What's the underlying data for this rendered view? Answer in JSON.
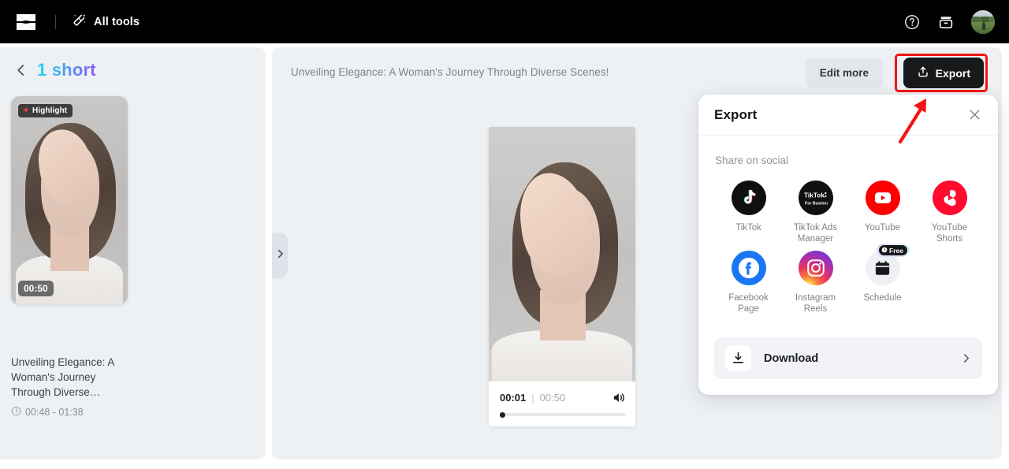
{
  "topbar": {
    "logo_name": "capcut-logo",
    "all_tools_label": "All tools",
    "help_icon": "help-circle-icon",
    "storage_icon": "storage-icon",
    "avatar_name": "user-avatar"
  },
  "sidebar": {
    "back_label": "back-chevron",
    "heading": "1 short",
    "clip": {
      "highlight_badge": "Highlight",
      "duration_badge": "00:50",
      "title": "Unveiling Elegance: A Woman's Journey Through Diverse…",
      "time_range": "00:48 - 01:38",
      "clock_icon": "clock-icon"
    }
  },
  "main": {
    "video_title": "Unveiling Elegance: A Woman's Journey Through Diverse Scenes!",
    "edit_more_label": "Edit more",
    "export_label": "Export",
    "export_icon": "upload-icon",
    "collapse_icon": "chevron-right-icon"
  },
  "player": {
    "current_time": "00:01",
    "separator": "|",
    "total_time": "00:50",
    "volume_icon": "volume-icon",
    "progress_percent": 2
  },
  "export_dialog": {
    "title": "Export",
    "close_icon": "close-icon",
    "share_section_label": "Share on social",
    "socials": [
      {
        "label": "TikTok",
        "icon": "tiktok-icon"
      },
      {
        "label": "TikTok Ads Manager",
        "icon": "tiktok-ads-manager-icon"
      },
      {
        "label": "YouTube",
        "icon": "youtube-icon"
      },
      {
        "label": "YouTube Shorts",
        "icon": "youtube-shorts-icon"
      },
      {
        "label": "Facebook Page",
        "icon": "facebook-icon"
      },
      {
        "label": "Instagram Reels",
        "icon": "instagram-icon"
      },
      {
        "label": "Schedule",
        "icon": "calendar-icon",
        "badge": "Free"
      }
    ],
    "download": {
      "label": "Download",
      "icon": "download-icon",
      "chevron": "chevron-right-icon"
    }
  },
  "annotation": {
    "highlight_color": "#f41414",
    "arrow_name": "red-pointer-arrow"
  },
  "colors": {
    "topbar_bg": "#000000",
    "panel_bg": "#eef1f4",
    "accent_gradient_start": "#25d3e8",
    "accent_gradient_end": "#8b5cf6",
    "export_button_bg": "#18191b",
    "annotation_red": "#f41414"
  }
}
